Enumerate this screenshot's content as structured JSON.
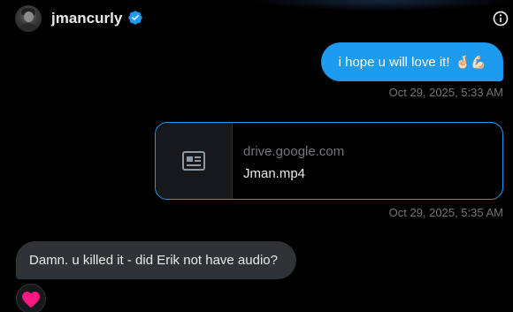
{
  "header": {
    "username": "jmancurly",
    "verified": true,
    "avatar_icon": "user-avatar",
    "info_icon": "info-icon"
  },
  "messages": [
    {
      "direction": "outgoing",
      "text": "i hope u will love it!",
      "emoji": "🤞🏻💪🏻",
      "timestamp": "Oct 29, 2025, 5:33 AM"
    },
    {
      "direction": "outgoing",
      "type": "link-card",
      "domain": "drive.google.com",
      "title": "Jman.mp4",
      "icon": "article-icon",
      "timestamp": "Oct 29, 2025, 5:35 AM"
    },
    {
      "direction": "incoming",
      "text": "Damn. u killed it - did Erik not have audio?",
      "reaction": "❤️"
    }
  ],
  "colors": {
    "accent": "#1d9bf0",
    "background": "#000000",
    "incoming_bubble": "#2f3336",
    "muted_text": "#71767b",
    "reaction_heart": "#f91880"
  }
}
